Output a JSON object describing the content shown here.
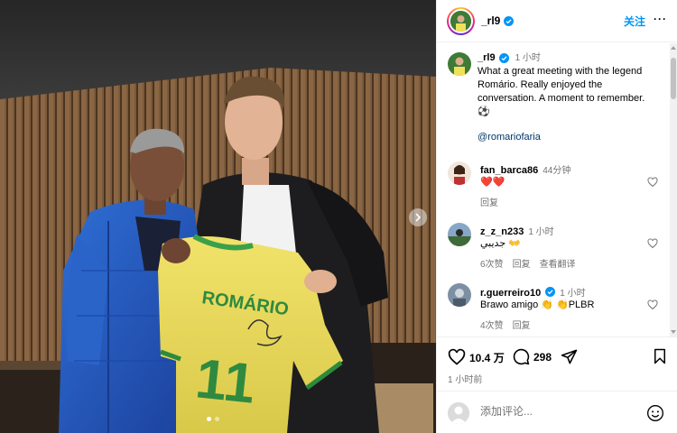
{
  "post": {
    "username": "_rl9",
    "follow_label": "关注",
    "more_label": "···",
    "caption": {
      "username": "_rl9",
      "time": "1 小时",
      "text": "What a great meeting with the legend Romário. Really enjoyed the conversation. A moment to remember. ⚽",
      "mention": "@romariofaria"
    },
    "photo": {
      "jersey_name": "ROMÁRIO",
      "jersey_number": "11",
      "slide_count": 2,
      "active_slide": 1
    }
  },
  "comments": [
    {
      "username": "fan_barca86",
      "time": "44分钟",
      "text": "❤️❤️",
      "likes": "",
      "reply": "回复",
      "translate": ""
    },
    {
      "username": "z_z_n233",
      "time": "1 小时",
      "text": "جديبي 👐",
      "likes": "6次赞",
      "reply": "回复",
      "translate": "查看翻译"
    },
    {
      "username": "r.guerreiro10",
      "time": "1 小时",
      "text": "Brawo amigo 👏 👏PLBR",
      "likes": "4次赞",
      "reply": "回复",
      "translate": ""
    }
  ],
  "actions": {
    "likes": "10.4 万",
    "comments": "298",
    "timestamp": "1 小时前"
  },
  "input": {
    "placeholder": "添加评论..."
  },
  "colors": {
    "accent": "#0095f6",
    "verified": "#0095f6",
    "muted": "#737373",
    "heart": "#ed4956"
  }
}
